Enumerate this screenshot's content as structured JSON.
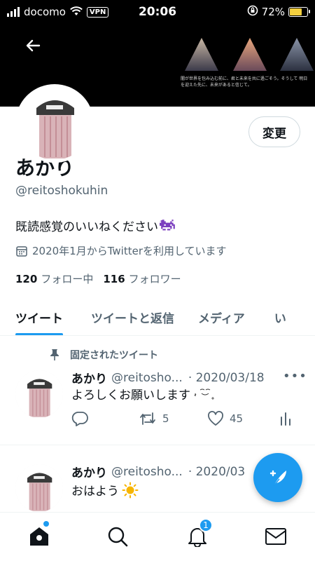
{
  "status_bar": {
    "carrier": "docomo",
    "vpn": "VPN",
    "time": "20:06",
    "battery": "72%",
    "battery_level": 0.72
  },
  "banner": {
    "caption": "闇が世界を包み込む前に、君と未来を共に過ごそう。そうして 明日を迎えた先に、未来があると信じて。"
  },
  "profile": {
    "edit_label": "変更",
    "display_name": "あかり",
    "handle": "@reitoshokuhin",
    "bio": "既読感覚のいいねください",
    "joined": "2020年1月からTwitterを利用しています",
    "following_count": "120",
    "following_label": "フォロー中",
    "followers_count": "116",
    "followers_label": "フォロワー"
  },
  "tabs": [
    {
      "label": "ツイート"
    },
    {
      "label": "ツイートと返信"
    },
    {
      "label": "メディア"
    },
    {
      "label": "い"
    }
  ],
  "tweets": [
    {
      "pinned_label": "固定されたツイート",
      "name": "あかり",
      "handle": "@reitosho...",
      "date": "· 2020/03/18",
      "text": "よろしくお願いします",
      "retweets": "5",
      "likes": "45"
    },
    {
      "name": "あかり",
      "handle": "@reitosho...",
      "date": "· 2020/03",
      "text": "おはよう"
    }
  ],
  "nav": {
    "notifications_badge": "1"
  },
  "colors": {
    "accent": "#1d9bf0",
    "secondary_text": "#536471"
  }
}
